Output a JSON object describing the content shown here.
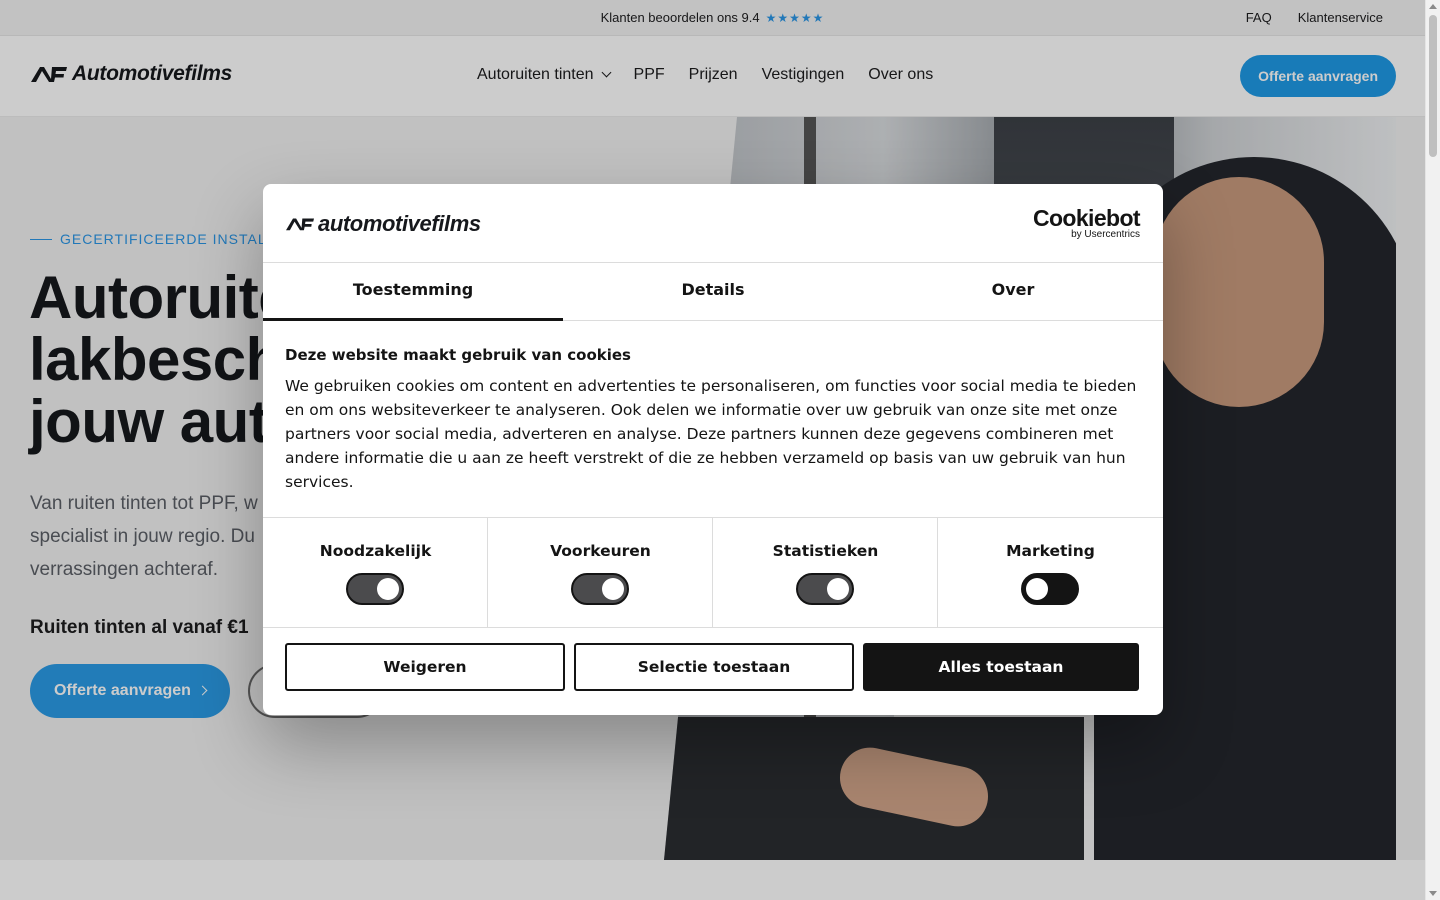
{
  "topbar": {
    "rating_text": "Klanten beoordelen ons 9.4",
    "stars": "★★★★★",
    "links": [
      "FAQ",
      "Klantenservice"
    ]
  },
  "header": {
    "logo_text": "Automotivefilms",
    "nav": [
      "Autoruiten tinten",
      "PPF",
      "Prijzen",
      "Vestigingen",
      "Over ons"
    ],
    "cta": "Offerte aanvragen"
  },
  "hero": {
    "eyebrow": "GECERTIFICEERDE INSTALL",
    "title_lines": [
      "Autoruite",
      "lakbesch",
      "jouw aut"
    ],
    "text_lines": [
      "Van ruiten tinten tot PPF, w",
      "specialist in jouw regio. Du",
      "verrassingen achteraf."
    ],
    "price": "Ruiten tinten al vanaf €1",
    "cta": "Offerte aanvragen"
  },
  "dialog": {
    "logo_text": "automotivefilms",
    "cookiebot_name": "Cookiebot",
    "cookiebot_by": "by Usercentrics",
    "tabs": [
      {
        "label": "Toestemming",
        "active": true
      },
      {
        "label": "Details",
        "active": false
      },
      {
        "label": "Over",
        "active": false
      }
    ],
    "title": "Deze website maakt gebruik van cookies",
    "text": "We gebruiken cookies om content en advertenties te personaliseren, om functies voor social media te bieden en om ons websiteverkeer te analyseren. Ook delen we informatie over uw gebruik van onze site met onze partners voor social media, adverteren en analyse. Deze partners kunnen deze gegevens combineren met andere informatie die u aan ze heeft verstrekt of die ze hebben verzameld op basis van uw gebruik van hun services.",
    "toggles": [
      {
        "label": "Noodzakelijk",
        "on": true
      },
      {
        "label": "Voorkeuren",
        "on": true
      },
      {
        "label": "Statistieken",
        "on": true
      },
      {
        "label": "Marketing",
        "on": false
      }
    ],
    "buttons": {
      "decline": "Weigeren",
      "selection": "Selectie toestaan",
      "accept_all": "Alles toestaan"
    }
  },
  "colors": {
    "brand_blue": "#1f9ae6",
    "dark": "#141414"
  }
}
